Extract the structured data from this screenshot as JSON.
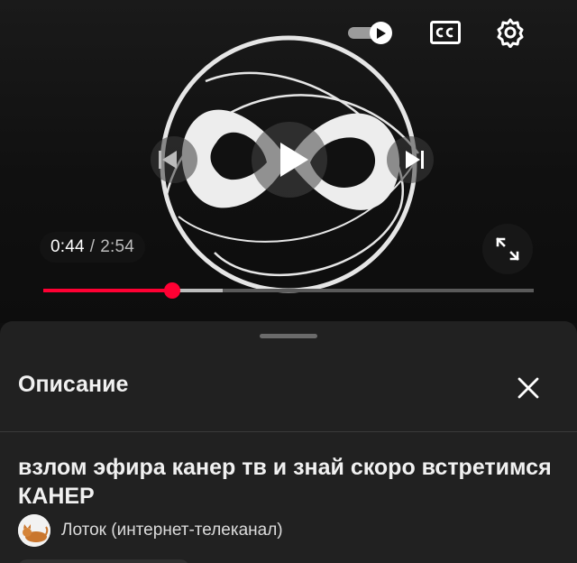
{
  "player": {
    "icons": {
      "logo": "infinity-logo-icon",
      "play": "play-icon",
      "previous": "previous-icon",
      "next": "next-icon",
      "autoplay": "autoplay-toggle-icon",
      "captions": "captions-icon",
      "settings": "gear-icon",
      "fullscreen": "fullscreen-icon"
    },
    "autoplay_on": true,
    "time": {
      "current": "0:44",
      "separator": "/",
      "total": "2:54"
    },
    "progress": {
      "played_fraction": 0.262,
      "buffered_fraction": 0.365
    },
    "colors": {
      "progress_played": "#ff0033",
      "progress_buffered": "#bdbdbd",
      "progress_bg": "#5a5a5a"
    }
  },
  "description_sheet": {
    "title": "Описание",
    "close_icon": "close-icon",
    "video_title": "взлом эфира канер тв и знай скоро встретимся КАНЕР",
    "channel_name": "Лоток (интернет-телеканал)",
    "channel_avatar_icon": "cat-avatar-icon"
  }
}
